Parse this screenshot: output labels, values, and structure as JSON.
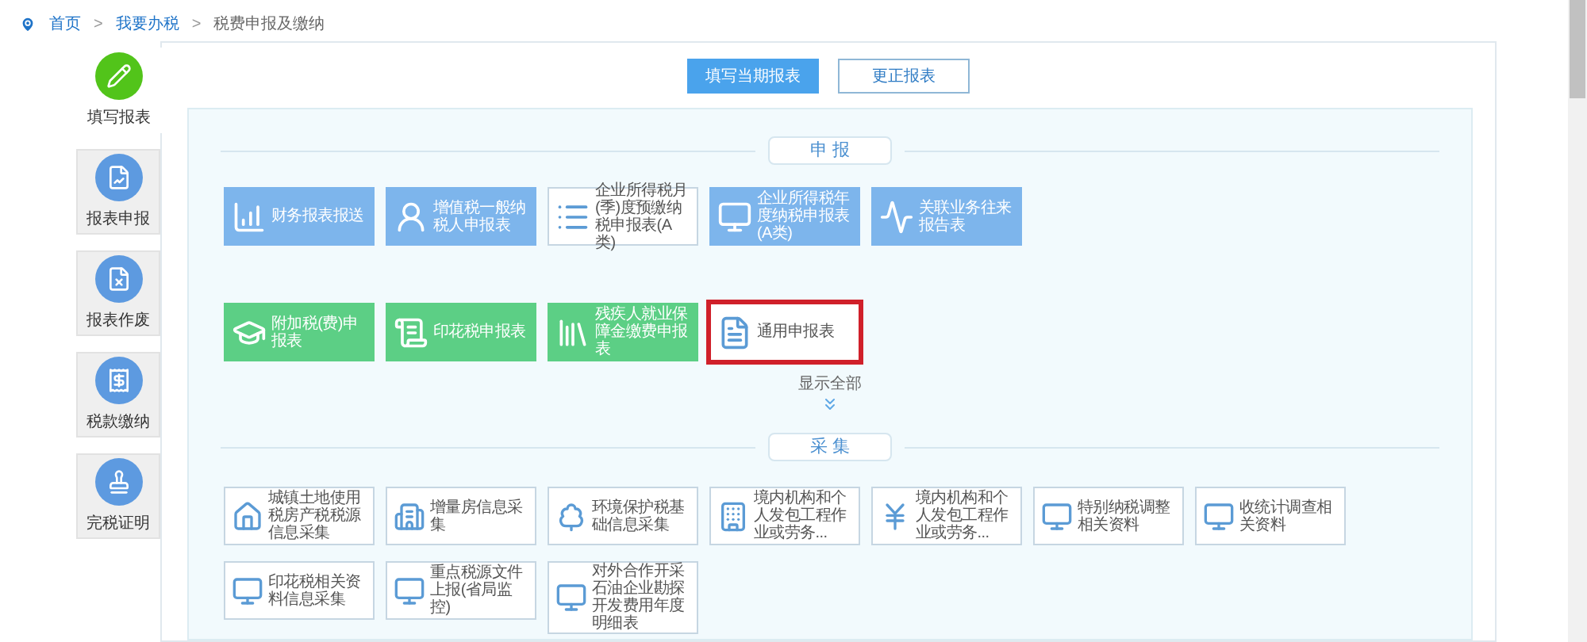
{
  "breadcrumb": [
    "首页",
    "我要办税",
    "税费申报及缴纳"
  ],
  "breadcrumb_separators": [
    ">",
    ">"
  ],
  "sidebar": {
    "items": [
      {
        "label": "填写报表",
        "selected": true
      },
      {
        "label": "报表申报",
        "selected": false
      },
      {
        "label": "报表作废",
        "selected": false
      },
      {
        "label": "税款缴纳",
        "selected": false
      },
      {
        "label": "完税证明",
        "selected": false
      }
    ]
  },
  "top_tabs": [
    {
      "label": "填写当期报表",
      "selected": true
    },
    {
      "label": "更正报表",
      "selected": false
    }
  ],
  "declare_section": {
    "title": "申 报",
    "rows": [
      [
        {
          "label": "财务报表报送",
          "kind": "blue",
          "highlighted": false
        },
        {
          "label": "增值税一般纳税人申报表",
          "kind": "blue",
          "highlighted": false
        },
        {
          "label": "企业所得税月(季)度预缴纳税申报表(A类)",
          "kind": "outline",
          "highlighted": false
        },
        {
          "label": "企业所得税年度纳税申报表(A类)",
          "kind": "blue",
          "highlighted": false
        },
        {
          "label": "关联业务往来报告表",
          "kind": "blue",
          "highlighted": false
        }
      ],
      [
        {
          "label": "附加税(费)申报表",
          "kind": "green",
          "highlighted": false
        },
        {
          "label": "印花税申报表",
          "kind": "green",
          "highlighted": false
        },
        {
          "label": "残疾人就业保障金缴费申报表",
          "kind": "green",
          "highlighted": false
        },
        {
          "label": "通用申报表",
          "kind": "outline",
          "highlighted": true
        }
      ]
    ],
    "show_all": "显示全部"
  },
  "collect_section": {
    "title": "采 集",
    "tiles": [
      {
        "label": "城镇土地使用税房产税税源信息采集"
      },
      {
        "label": "增量房信息采集"
      },
      {
        "label": "环境保护税基础信息采集"
      },
      {
        "label": "境内机构和个人发包工程作业或劳务..."
      },
      {
        "label": "境内机构和个人发包工程作业或劳务..."
      },
      {
        "label": "特别纳税调整相关资料"
      },
      {
        "label": "收统计调查相关资料"
      },
      {
        "label": "印花税相关资料信息采集"
      },
      {
        "label": "重点税源文件上报(省局监控)"
      },
      {
        "label": "对外合作开采石油企业勘探开发费用年度明细表"
      }
    ]
  }
}
